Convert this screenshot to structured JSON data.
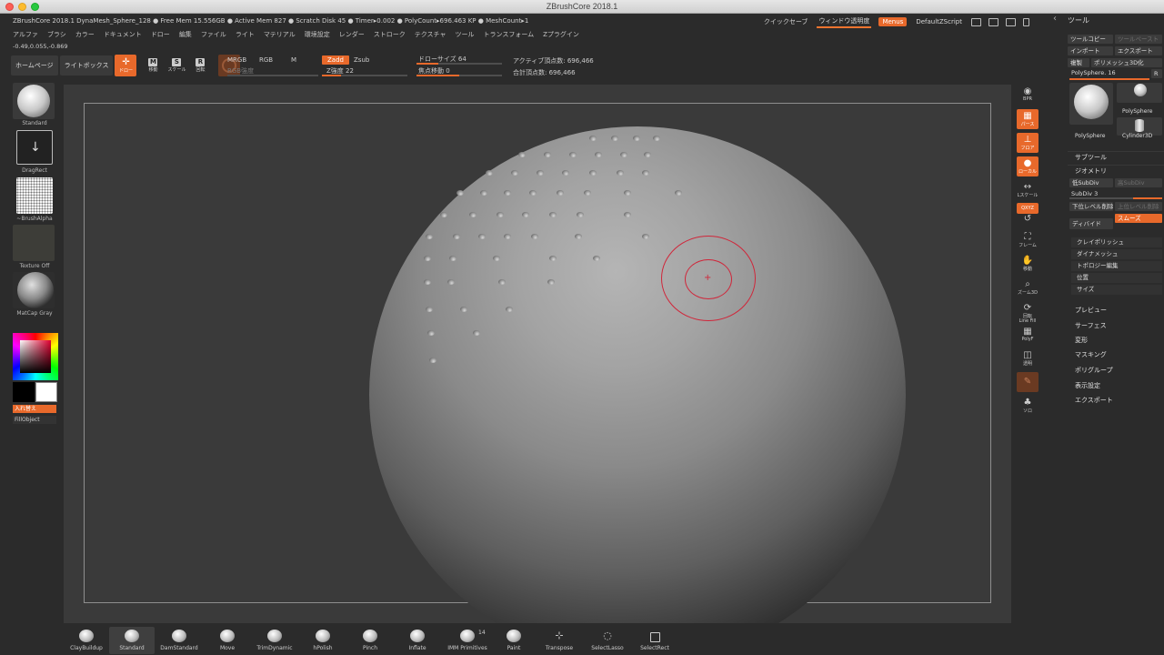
{
  "window": {
    "title": "ZBrushCore 2018.1"
  },
  "status": {
    "info": "ZBrushCore 2018.1  DynaMesh_Sphere_128   ● Free Mem 15.556GB ● Active Mem 827 ● Scratch Disk 45 ● Timer▸0.002 ● PolyCount▸696.463 KP ● MeshCount▸1",
    "coords": "-0.49,0.055,-0.869"
  },
  "top_right": {
    "quicksave": "クイックセーブ",
    "transparency": "ウィンドウ透明度",
    "menus": "Menus",
    "zscript": "DefaultZScript"
  },
  "menubar": [
    "アルファ",
    "ブラシ",
    "カラー",
    "ドキュメント",
    "ドロー",
    "編集",
    "ファイル",
    "ライト",
    "マテリアル",
    "環境設定",
    "レンダー",
    "ストローク",
    "テクスチャ",
    "ツール",
    "トランスフォーム",
    "Zプラグイン"
  ],
  "tool_header": "ツール",
  "shelf": {
    "home": "ホームページ",
    "lightbox": "ライトボックス",
    "draw": "ドロー",
    "move": "移動",
    "scale": "スケール",
    "rotate": "回転"
  },
  "params": {
    "mrgb": "MRGB",
    "rgb": "RGB",
    "m": "M",
    "rgb_intensity": "RGB強度",
    "zadd": "Zadd",
    "zsub": "Zsub",
    "z_intensity": "Z強度 22",
    "draw_size": "ドローサイズ 64",
    "focal_shift": "焦点移動 0",
    "active_points": "アクティブ頂点数: 696,466",
    "total_points": "合計頂点数: 696,466",
    "z_intensity_fill": 0.22,
    "draw_size_fill": 0.25,
    "focal_fill": 0.5
  },
  "left": {
    "brush": "Standard",
    "stroke": "DragRect",
    "alpha": "~BrushAlpha",
    "texture": "Texture Off",
    "material": "MatCap Gray",
    "swap": "入れ替え",
    "fill": "FillObject"
  },
  "right_strip": {
    "bpr": "BPR",
    "persp": "パース",
    "floor": "フロア",
    "local": "ローカル",
    "scale": "Lスケール",
    "xyz": "QXYZ",
    "frame": "フレーム",
    "move": "移動",
    "zoom3d": "ズーム3D",
    "rotate": "回転",
    "linefill": "Line Fill",
    "polyf": "PolyF",
    "transp": "透明",
    "solo": "ソロ"
  },
  "tool_panel": {
    "copy_tool": "ツールコピー",
    "paste_tool": "ツールペースト",
    "import": "インポート",
    "export": "エクスポート",
    "clone": "複製",
    "polymesh": "ポリメッシュ3D化",
    "polysphere_slider": "PolySphere. 16",
    "r": "R",
    "thumb_main": "PolySphere",
    "thumb_small": "PolySphere",
    "thumb_cyl": "Cylinder3D",
    "subtool": "サブツール",
    "geometry": "ジオメトリ",
    "lower_subdiv": "低SubDiv",
    "higher_subdiv": "高SubDiv",
    "subdiv": "SubDiv 3",
    "del_lower": "下位レベル削除",
    "del_higher": "上位レベル削除",
    "divide": "ディバイド",
    "smooth": "スムーズ",
    "sections": [
      "クレイポリッシュ",
      "ダイナメッシュ",
      "トポロジー編集",
      "位置",
      "サイズ"
    ],
    "main_sections": [
      "プレビュー",
      "サーフェス",
      "変形",
      "マスキング",
      "ポリグループ",
      "表示設定",
      "エクスポート"
    ]
  },
  "bottom": [
    "ClayBuildup",
    "Standard",
    "DamStandard",
    "Move",
    "TrimDynamic",
    "hPolish",
    "Pinch",
    "Inflate",
    "IMM Primitives",
    "Paint",
    "Transpose",
    "SelectLasso",
    "SelectRect"
  ],
  "imm_count": "14"
}
